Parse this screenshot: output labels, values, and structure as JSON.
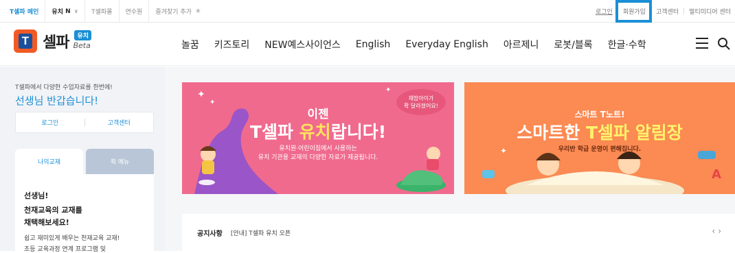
{
  "topbar": {
    "left_items": [
      "T셀파 메인",
      "유치",
      "T셀파몰",
      "연수원",
      "즐겨찾기 추가"
    ],
    "yuchi_badge": "N",
    "right_links": [
      "로그인",
      "회원가입",
      "고객센터",
      "멀티미디어 센터"
    ]
  },
  "header": {
    "logo_name": "셀파",
    "logo_badge": "유치",
    "logo_beta": "Beta",
    "nav": [
      "놀꿈",
      "키즈토리",
      "NEW예스사이언스",
      "English",
      "Everyday English",
      "아르제니",
      "로봇/블록",
      "한글·수학"
    ]
  },
  "sidebar": {
    "intro": "T셀파에서 다양한 수업자료를 한번에!",
    "greeting": "선생님 반갑습니다!",
    "login": "로그인",
    "support": "고객센터",
    "tab_my": "나의교재",
    "tab_quick": "퀵 메뉴",
    "panel": {
      "line1": "선생님!",
      "line2": "천재교육의 교재를",
      "line3": "채택해보세요!",
      "line4": "쉽고 재미있게 배우는 천재교육 교재!",
      "line5": "초등 교육과정 연계 프로그램 및"
    }
  },
  "banners": {
    "left": {
      "title1": "이젠",
      "title2a": "T셀파 ",
      "title2b": "유치",
      "title2c": "랍니다!",
      "desc1": "유치원·어린이집에서 사용하는",
      "desc2": "유치 기관용 교재의 다양한 자료가 제공됩니다.",
      "bubble1": "채밥아이가",
      "bubble2": "확 달라졌어요!"
    },
    "right": {
      "title1": "스마트 T노트!",
      "title2a": "스마트한 ",
      "title2b": "T셀파 알림장",
      "desc": "우리반 학급 운영이 편해집니다."
    }
  },
  "notice": {
    "label": "공지사항",
    "text": "[안내] T셀파 유치 오픈",
    "prev": "‹",
    "next": "›"
  },
  "colors": {
    "accent": "#1a8fd6",
    "logo_orange": "#f15a24",
    "banner_pink": "#f06a8e",
    "banner_orange": "#fb8a53"
  }
}
